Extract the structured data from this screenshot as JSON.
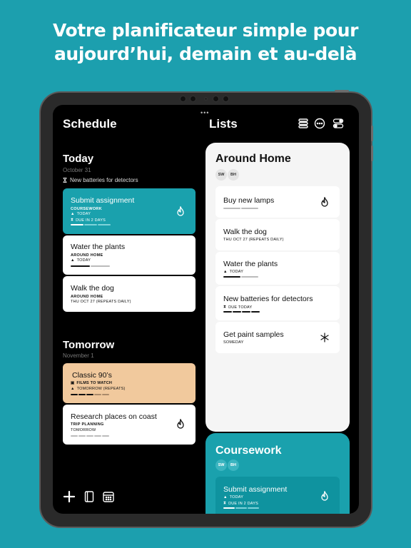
{
  "headline": {
    "line1": "Votre planificateur simple pour",
    "line2": "aujourd’hui, demain et au-delà"
  },
  "colors": {
    "background": "#1c9fae",
    "accent": "#1aa1ad",
    "tan": "#f1c99d"
  },
  "topbar": {
    "dots": "•••"
  },
  "schedule": {
    "title": "Schedule",
    "today": {
      "title": "Today",
      "date": "October 31",
      "reminder": "New batteries for detectors",
      "cards": [
        {
          "title": "Submit assignment",
          "category": "COURSEWORK",
          "meta1": "TODAY",
          "meta2": "DUE IN 2 DAYS",
          "progress": 0.4
        },
        {
          "title": "Water the plants",
          "category": "AROUND HOME",
          "meta1": "TODAY",
          "progress": 0.5
        },
        {
          "title": "Walk the dog",
          "category": "AROUND HOME",
          "meta1": "THU OCT 27 (REPEATS DAILY)"
        }
      ]
    },
    "tomorrow": {
      "title": "Tomorrow",
      "date": "November 1",
      "cards": [
        {
          "title": "Classic 90’s",
          "category": "FILMS TO WATCH",
          "meta1": "TOMORROW (REPEATS)",
          "progress": 0.6
        },
        {
          "title": "Research places on coast",
          "category": "TRIP PLANNING",
          "meta1": "TOMORROW",
          "progress": 0
        }
      ]
    }
  },
  "lists": {
    "title": "Lists",
    "around_home": {
      "title": "Around Home",
      "avatars": [
        "SW",
        "BH"
      ],
      "items": [
        {
          "title": "Buy new lamps",
          "progress": 0.5
        },
        {
          "title": "Walk the dog",
          "meta": "THU OCT 27 (REPEATS DAILY)"
        },
        {
          "title": "Water the plants",
          "meta": "TODAY",
          "progress": 0.5
        },
        {
          "title": "New batteries for detectors",
          "meta": "DUE TODAY",
          "progress": 1.0
        },
        {
          "title": "Get paint samples",
          "meta": "SOMEDAY"
        }
      ]
    },
    "coursework": {
      "title": "Coursework",
      "avatars": [
        "SW",
        "BH"
      ],
      "item": {
        "title": "Submit assignment",
        "meta1": "TODAY",
        "meta2": "DUE IN 2 DAYS",
        "progress": 0.4
      }
    }
  },
  "icons": {
    "list_view": "stack-icon",
    "more": "ellipsis-circle-icon",
    "toggle": "toggles-icon",
    "flame": "flame-icon",
    "snowflake": "snowflake-icon",
    "add": "plus-icon",
    "book": "book-icon",
    "calendar": "calendar-icon"
  }
}
